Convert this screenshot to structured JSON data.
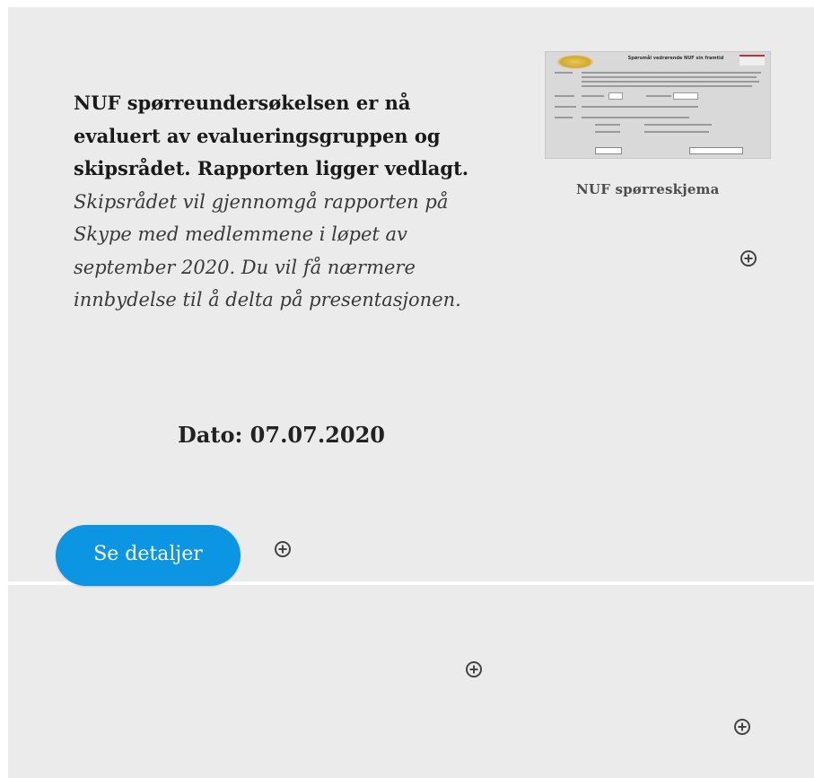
{
  "intro": {
    "bold_text": "NUF spørreundersøkelsen er  nå evaluert av evalueringsgruppen og skipsrådet. Rapporten  ligger vedlagt.",
    "italic_text": "Skipsrådet vil gjennomgå rapporten på Skype med medlemmene i løpet av september 2020. Du vil få nærmere innbydelse til å delta på presentasjonen."
  },
  "date_text": "Dato: 07.07.2020",
  "attachment": {
    "thumbnail_title": "Spørsmål vedrørende NUF sin framtid",
    "caption": "NUF spørreskjema"
  },
  "details_button": {
    "label": "Se detaljer"
  },
  "colors": {
    "panel_background": "#ebebeb",
    "button_background": "#0c95e2",
    "button_text": "#ffffff"
  },
  "icons": [
    "plus-circle-icon",
    "plus-circle-icon",
    "plus-circle-icon",
    "plus-circle-icon"
  ]
}
